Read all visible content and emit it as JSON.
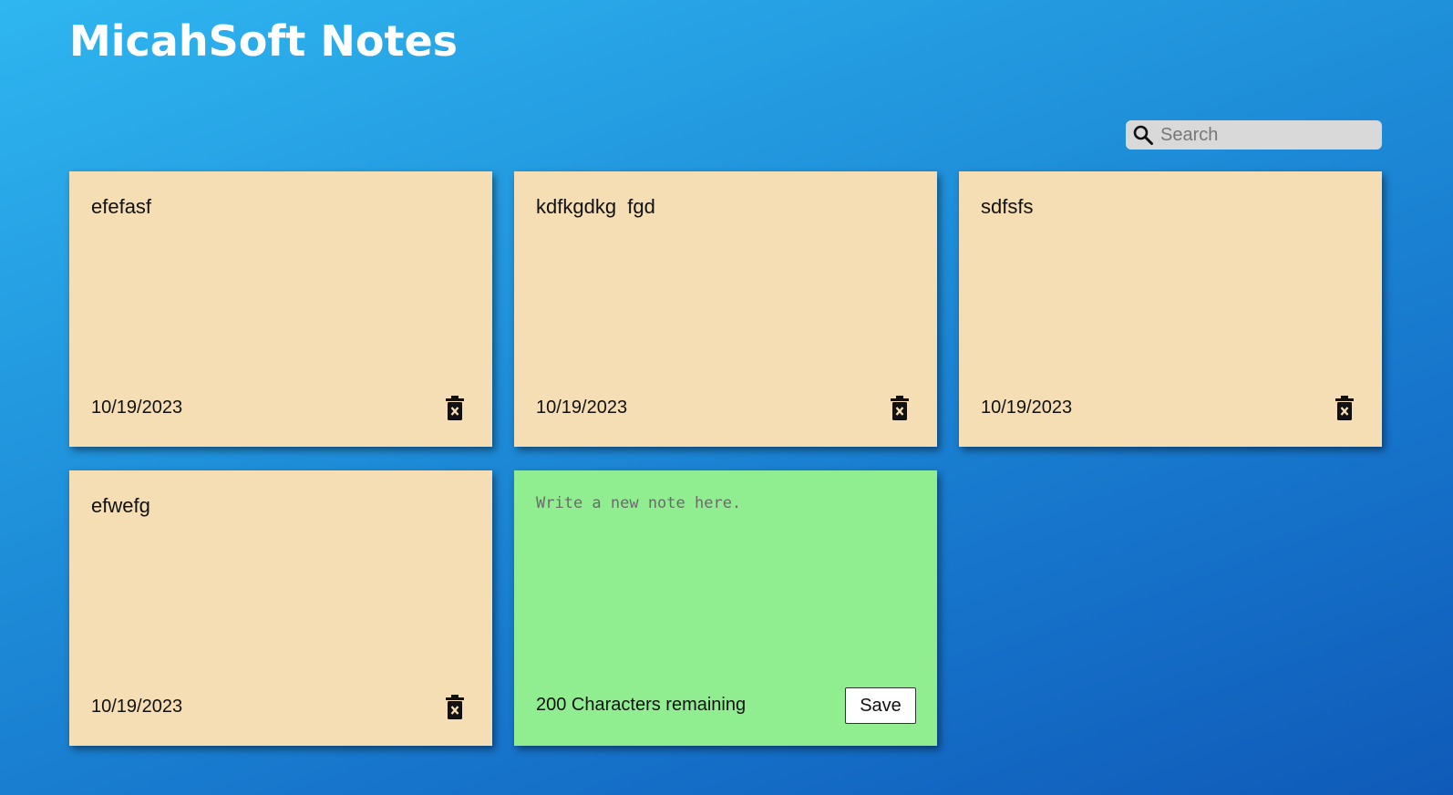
{
  "header": {
    "title": "MicahSoft Notes"
  },
  "search": {
    "placeholder": "Search",
    "value": ""
  },
  "notes": [
    {
      "text": "efefasf",
      "date": "10/19/2023"
    },
    {
      "text": "kdfkgdkg  fgd",
      "date": "10/19/2023"
    },
    {
      "text": "sdfsfs",
      "date": "10/19/2023"
    },
    {
      "text": "efwefg",
      "date": "10/19/2023"
    }
  ],
  "new_note": {
    "placeholder": "Write a new note here.",
    "value": "",
    "remaining": "200 Characters remaining",
    "save_label": "Save"
  },
  "colors": {
    "note_bg": "#f5deb3",
    "new_note_bg": "#90ee90",
    "search_bg": "#d9d9d9",
    "title": "#ffffff"
  },
  "icons": {
    "search": "search-icon",
    "delete": "trash-icon"
  }
}
